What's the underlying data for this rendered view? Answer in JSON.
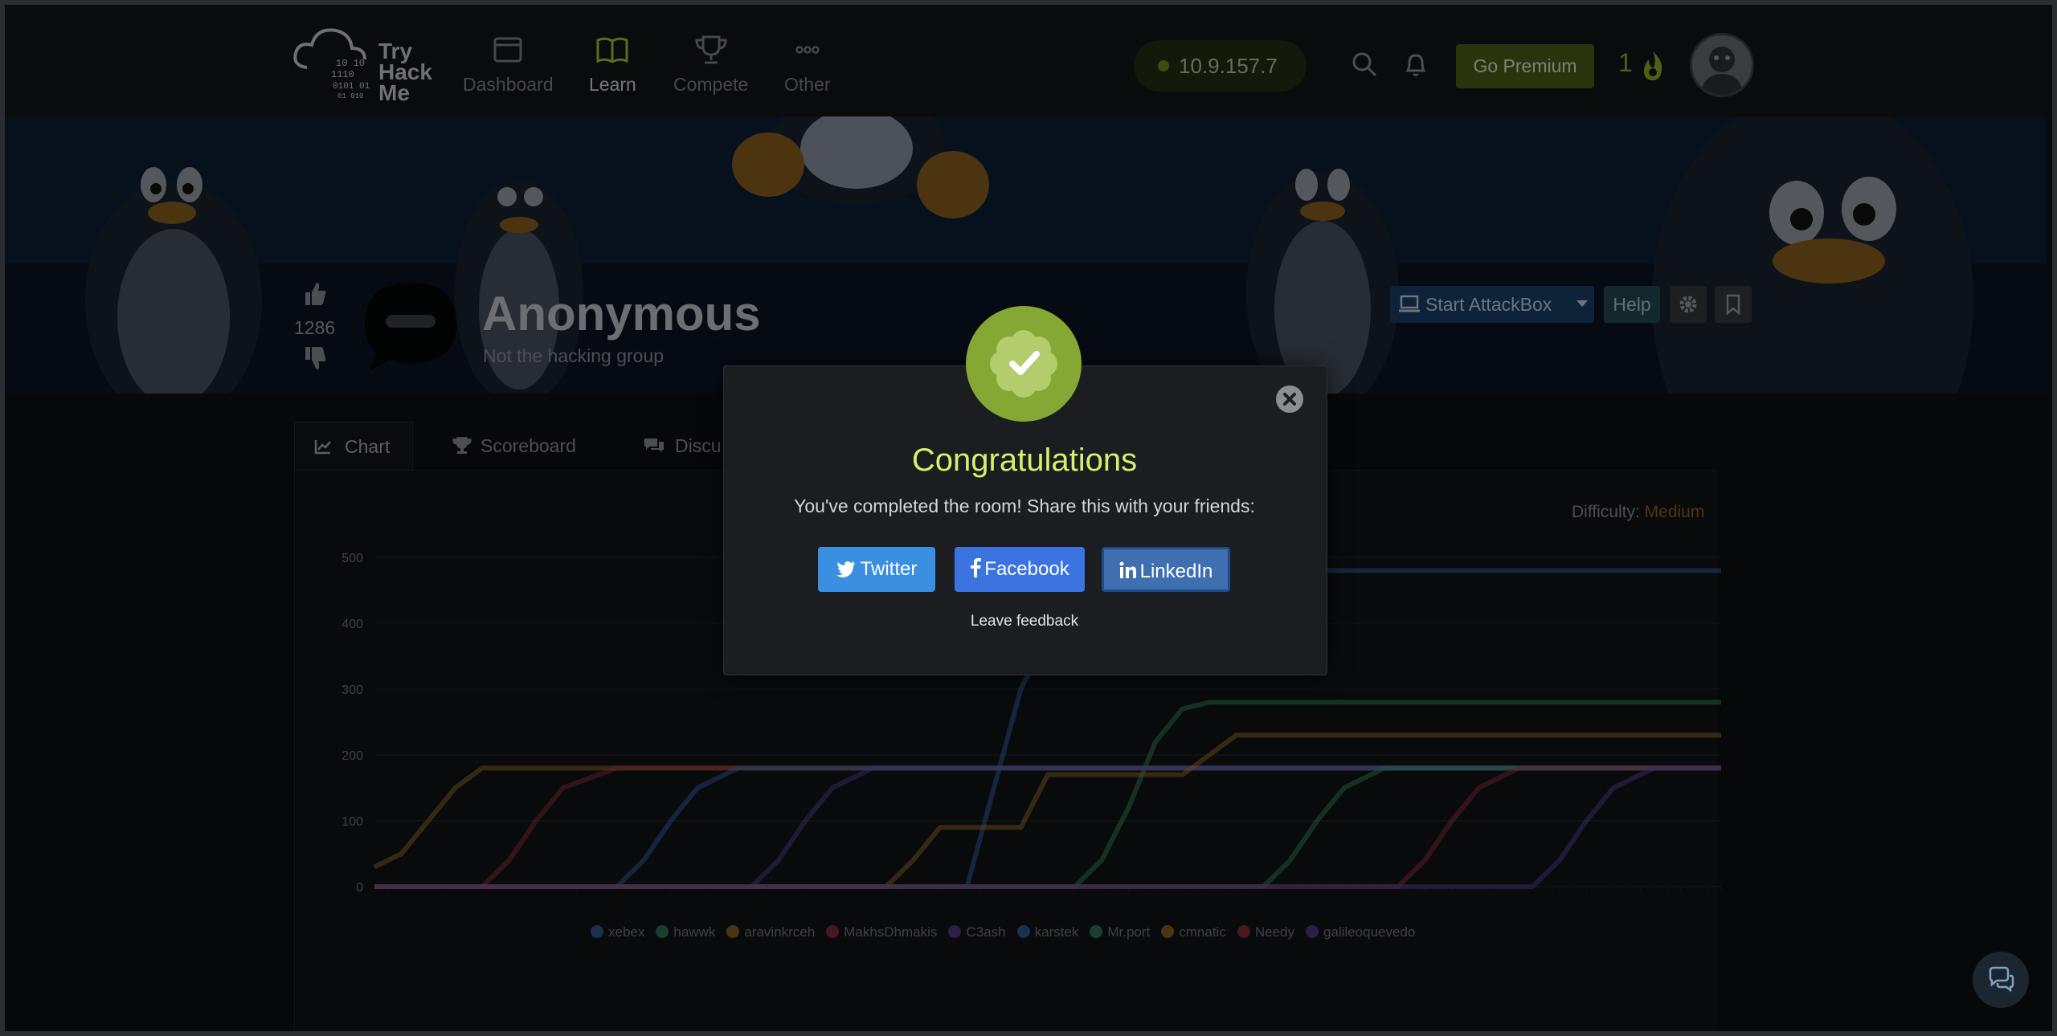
{
  "nav": {
    "logo_lines": [
      "Try",
      "Hack",
      "Me"
    ],
    "items": [
      {
        "label": "Dashboard",
        "icon": "dashboard-icon"
      },
      {
        "label": "Learn",
        "icon": "book-icon"
      },
      {
        "label": "Compete",
        "icon": "trophy-icon"
      },
      {
        "label": "Other",
        "icon": "more-icon"
      }
    ],
    "active": "Learn",
    "ip_address": "10.9.157.7",
    "premium_label": "Go Premium",
    "streak": "1"
  },
  "room": {
    "title": "Anonymous",
    "subtitle": "Not the hacking group",
    "votes": "1286",
    "attackbox_label": "Start AttackBox",
    "help_label": "Help"
  },
  "tabs": [
    {
      "label": "Chart",
      "icon": "chart-icon"
    },
    {
      "label": "Scoreboard",
      "icon": "trophy-icon"
    },
    {
      "label": "Discu",
      "icon": "comments-icon"
    }
  ],
  "difficulty": {
    "label": "Difficulty:",
    "value": "Medium"
  },
  "modal": {
    "title": "Congratulations",
    "message": "You've completed the room! Share this with your friends:",
    "buttons": [
      {
        "label": "Twitter",
        "icon": "twitter-icon",
        "color": "#3a8dde"
      },
      {
        "label": "Facebook",
        "icon": "facebook-icon",
        "color": "#3b73e0"
      },
      {
        "label": "LinkedIn",
        "icon": "linkedin-icon",
        "color": "#3d6fb0"
      }
    ],
    "feedback_label": "Leave feedback",
    "close_icon": "close-icon"
  },
  "colors": {
    "accent_green": "#84a833",
    "title_green": "#d8ee6c",
    "difficulty_medium": "#8a6422"
  },
  "chart_data": {
    "type": "line",
    "ylim": [
      0,
      500
    ],
    "yticks": [
      "0",
      "100",
      "200",
      "300",
      "400",
      "500"
    ],
    "x_points": 100,
    "legend_position": "bottom",
    "series": [
      {
        "name": "xebex",
        "color": "#3d76c8",
        "points": [
          [
            0,
            0
          ],
          [
            44,
            0
          ],
          [
            46,
            150
          ],
          [
            48,
            300
          ],
          [
            50,
            380
          ],
          [
            54,
            480
          ],
          [
            100,
            480
          ]
        ]
      },
      {
        "name": "hawwk",
        "color": "#38a36a",
        "points": [
          [
            0,
            0
          ],
          [
            52,
            0
          ],
          [
            54,
            40
          ],
          [
            56,
            120
          ],
          [
            58,
            220
          ],
          [
            60,
            270
          ],
          [
            62,
            280
          ],
          [
            100,
            280
          ]
        ]
      },
      {
        "name": "aravinkrceh",
        "color": "#b7812d",
        "points": [
          [
            0,
            30
          ],
          [
            2,
            50
          ],
          [
            4,
            100
          ],
          [
            6,
            150
          ],
          [
            8,
            180
          ],
          [
            100,
            180
          ]
        ]
      },
      {
        "name": "MakhsDhmakis",
        "color": "#b03a48",
        "points": [
          [
            0,
            0
          ],
          [
            8,
            0
          ],
          [
            10,
            40
          ],
          [
            12,
            100
          ],
          [
            14,
            150
          ],
          [
            18,
            180
          ],
          [
            100,
            180
          ]
        ]
      },
      {
        "name": "C3ash",
        "color": "#6a4bb7",
        "points": [
          [
            0,
            0
          ],
          [
            28,
            0
          ],
          [
            30,
            40
          ],
          [
            32,
            100
          ],
          [
            34,
            150
          ],
          [
            37,
            180
          ],
          [
            100,
            180
          ]
        ]
      },
      {
        "name": "karstek",
        "color": "#3d76c8",
        "points": [
          [
            0,
            0
          ],
          [
            18,
            0
          ],
          [
            20,
            40
          ],
          [
            22,
            100
          ],
          [
            24,
            150
          ],
          [
            27,
            180
          ],
          [
            100,
            180
          ]
        ]
      },
      {
        "name": "Mr.port",
        "color": "#38a36a",
        "points": [
          [
            0,
            0
          ],
          [
            66,
            0
          ],
          [
            68,
            40
          ],
          [
            70,
            100
          ],
          [
            72,
            150
          ],
          [
            75,
            180
          ],
          [
            100,
            180
          ]
        ]
      },
      {
        "name": "cmnatic",
        "color": "#b7812d",
        "points": [
          [
            0,
            0
          ],
          [
            38,
            0
          ],
          [
            40,
            40
          ],
          [
            42,
            90
          ],
          [
            48,
            90
          ],
          [
            50,
            170
          ],
          [
            60,
            170
          ],
          [
            62,
            200
          ],
          [
            64,
            230
          ],
          [
            100,
            230
          ]
        ]
      },
      {
        "name": "Needy",
        "color": "#b03a48",
        "points": [
          [
            0,
            0
          ],
          [
            76,
            0
          ],
          [
            78,
            40
          ],
          [
            80,
            100
          ],
          [
            82,
            150
          ],
          [
            85,
            180
          ],
          [
            100,
            180
          ]
        ]
      },
      {
        "name": "galileoquevedo",
        "color": "#6a4bb7",
        "points": [
          [
            0,
            0
          ],
          [
            86,
            0
          ],
          [
            88,
            40
          ],
          [
            90,
            100
          ],
          [
            92,
            150
          ],
          [
            95,
            180
          ],
          [
            100,
            180
          ]
        ]
      }
    ]
  }
}
